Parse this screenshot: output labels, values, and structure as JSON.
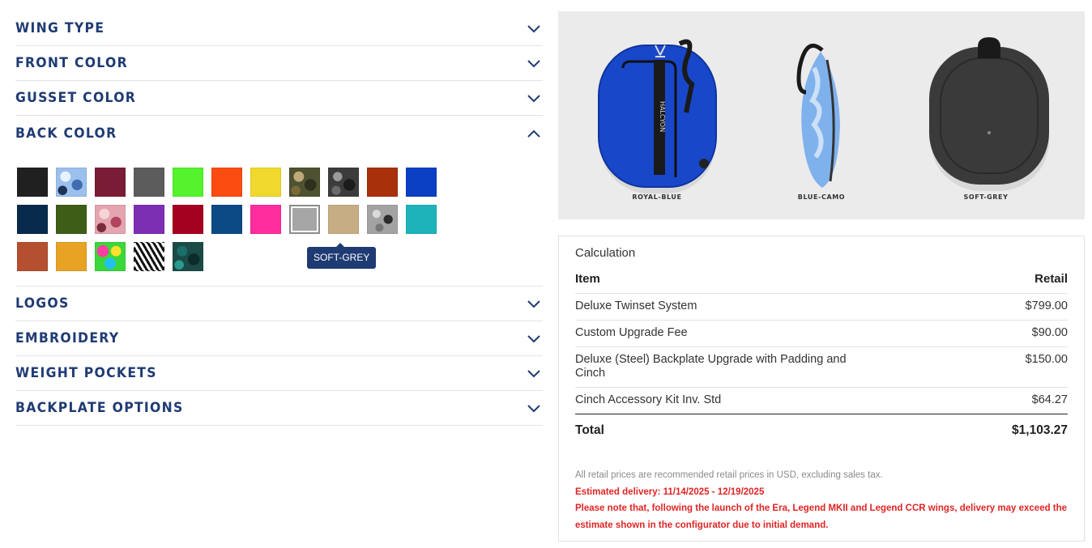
{
  "accordion": {
    "sections_top": [
      {
        "key": "wing_type",
        "label": "WING TYPE"
      },
      {
        "key": "front_color",
        "label": "FRONT COLOR"
      },
      {
        "key": "gusset_color",
        "label": "GUSSET COLOR"
      }
    ],
    "back_color": {
      "label": "BACK COLOR"
    },
    "sections_bottom": [
      {
        "key": "logos",
        "label": "LOGOS"
      },
      {
        "key": "embroidery",
        "label": "EMBROIDERY"
      },
      {
        "key": "weight_pockets",
        "label": "WEIGHT POCKETS"
      },
      {
        "key": "backplate_options",
        "label": "BACKPLATE OPTIONS"
      }
    ]
  },
  "swatches": {
    "rows": [
      [
        "#202020",
        "camo-blue",
        "#7a1c35",
        "#5c5c5c",
        "#55f22e",
        "#fb4c12",
        "#f0d92c",
        "camo-green",
        "camo-grey",
        "#a8310c",
        "#0b3fc4"
      ],
      [
        "#082a4d",
        "#3e5e17",
        "camo-pink",
        "#7d2fb4",
        "#a4001f",
        "#0c4a86",
        "#ff2d9d",
        "#a6a6a6",
        "#c7ad84",
        "camo-grey2",
        "#1eb3bb"
      ],
      [
        "#b4502f",
        "#e8a325",
        "tropical",
        "zebra",
        "camo-teal"
      ]
    ],
    "selected": "SOFT-GREY",
    "tooltip": "SOFT-GREY"
  },
  "product": {
    "captions": [
      "ROYAL-BLUE",
      "BLUE-CAMO",
      "SOFT-GREY"
    ],
    "colors": {
      "front": "#1947c9",
      "back": "#3a3a3a",
      "camo": "#7fb1ec"
    },
    "brand_text": "HALCYON"
  },
  "calculation": {
    "title": "Calculation",
    "header": {
      "item": "Item",
      "retail": "Retail"
    },
    "items": [
      {
        "name": "Deluxe Twinset System",
        "price": "$799.00"
      },
      {
        "name": "Custom Upgrade Fee",
        "price": "$90.00"
      },
      {
        "name": "Deluxe (Steel) Backplate Upgrade with Padding and Cinch",
        "price": "$150.00"
      },
      {
        "name": "Cinch Accessory Kit Inv. Std",
        "price": "$64.27"
      }
    ],
    "total_label": "Total",
    "total_value": "$1,103.27",
    "notes": {
      "disclaimer": "All retail prices are recommended retail prices in USD, excluding sales tax.",
      "delivery": "Estimated delivery: 11/14/2025 - 12/19/2025",
      "warning": "Please note that, following the launch of the Era, Legend MKII and Legend CCR wings, delivery may exceed the estimate shown in the configurator due to initial demand."
    }
  },
  "theme": {
    "accent": "#1f3b73",
    "warning": "#e02424"
  }
}
